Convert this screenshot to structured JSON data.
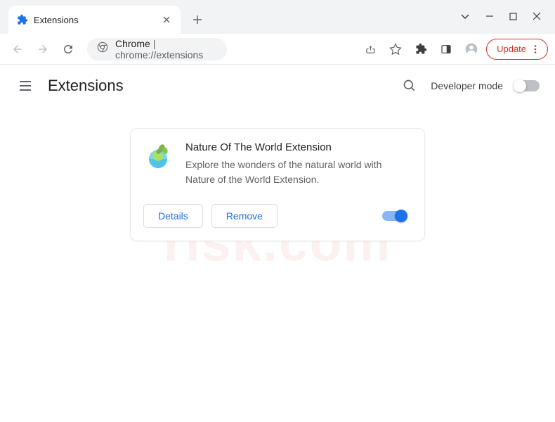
{
  "tab": {
    "title": "Extensions"
  },
  "omnibox": {
    "label": "Chrome",
    "url": "chrome://extensions"
  },
  "update_button": "Update",
  "ext_header": {
    "title": "Extensions",
    "dev_mode_label": "Developer mode"
  },
  "extension": {
    "name": "Nature Of The World Extension",
    "description": "Explore the wonders of the natural world with Nature of the World Extension.",
    "details_btn": "Details",
    "remove_btn": "Remove",
    "enabled": true
  }
}
